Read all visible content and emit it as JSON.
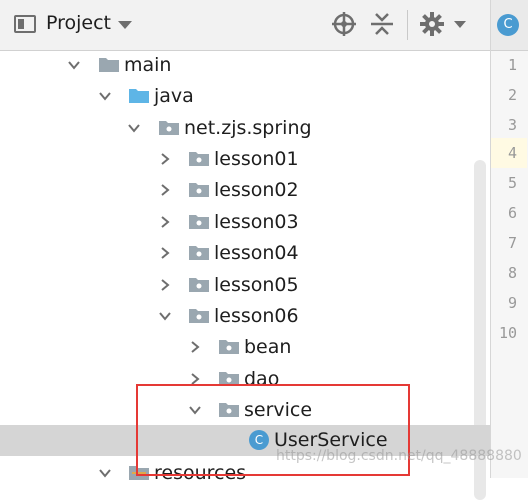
{
  "toolbar": {
    "title": "Project",
    "icons": [
      "project-view-icon",
      "dropdown-icon",
      "crosshair-icon",
      "collapse-all-icon",
      "gear-icon"
    ]
  },
  "editor_tab": {
    "icon_letter": "C"
  },
  "gutter": {
    "line_numbers": [
      "1",
      "2",
      "3",
      "4",
      "5",
      "6",
      "7",
      "8",
      "9",
      "10"
    ],
    "current_line": "4"
  },
  "tree": {
    "items": [
      {
        "label": "main",
        "expanded": true,
        "kind": "folder"
      },
      {
        "label": "java",
        "expanded": true,
        "kind": "source-folder"
      },
      {
        "label": "net.zjs.spring",
        "expanded": true,
        "kind": "package"
      },
      {
        "label": "lesson01",
        "expanded": false,
        "kind": "package"
      },
      {
        "label": "lesson02",
        "expanded": false,
        "kind": "package"
      },
      {
        "label": "lesson03",
        "expanded": false,
        "kind": "package"
      },
      {
        "label": "lesson04",
        "expanded": false,
        "kind": "package"
      },
      {
        "label": "lesson05",
        "expanded": false,
        "kind": "package"
      },
      {
        "label": "lesson06",
        "expanded": true,
        "kind": "package"
      },
      {
        "label": "bean",
        "expanded": false,
        "kind": "package"
      },
      {
        "label": "dao",
        "expanded": false,
        "kind": "package"
      },
      {
        "label": "service",
        "expanded": true,
        "kind": "package"
      },
      {
        "label": "UserService",
        "kind": "class",
        "icon_letter": "C",
        "selected": true
      },
      {
        "label": "resources",
        "expanded": true,
        "kind": "resources-folder"
      }
    ]
  },
  "colors": {
    "highlight_box": "#e53935",
    "selection": "#d5d5d5",
    "class_icon": "#4a9bd1",
    "source_folder": "#5eb5e6",
    "folder": "#9aa7b0"
  },
  "watermark": "https://blog.csdn.net/qq_48888880"
}
